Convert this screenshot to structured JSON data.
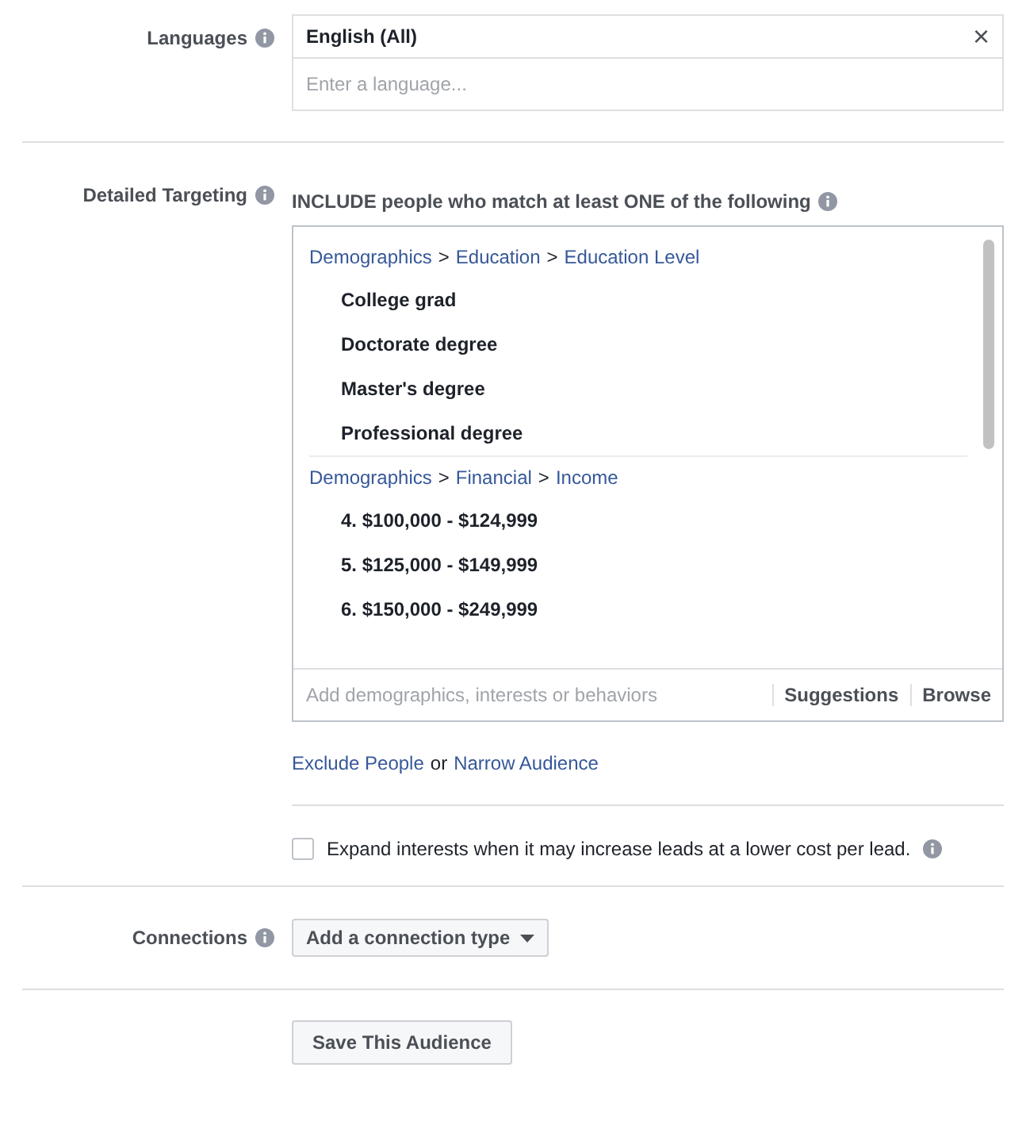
{
  "languages": {
    "label": "Languages",
    "selected_value": "English (All)",
    "remove_symbol": "×",
    "placeholder": "Enter a language..."
  },
  "detailed_targeting": {
    "label": "Detailed Targeting",
    "include_text": "INCLUDE people who match at least ONE of the following",
    "groups": [
      {
        "path": [
          "Demographics",
          "Education",
          "Education Level"
        ],
        "separator": ">",
        "items": [
          "College grad",
          "Doctorate degree",
          "Master's degree",
          "Professional degree"
        ]
      },
      {
        "path": [
          "Demographics",
          "Financial",
          "Income"
        ],
        "separator": ">",
        "items": [
          "4. $100,000 - $124,999",
          "5. $125,000 - $149,999",
          "6. $150,000 - $249,999"
        ]
      }
    ],
    "search_placeholder": "Add demographics, interests or behaviors",
    "actions": [
      "Suggestions",
      "Browse"
    ],
    "exclude_link": "Exclude People",
    "or_text": "or",
    "narrow_link": "Narrow Audience",
    "expand": {
      "text": "Expand interests when it may increase leads at a lower cost per lead.",
      "checked": false
    }
  },
  "connections": {
    "label": "Connections",
    "dropdown": "Add a connection type"
  },
  "save_button": "Save This Audience"
}
